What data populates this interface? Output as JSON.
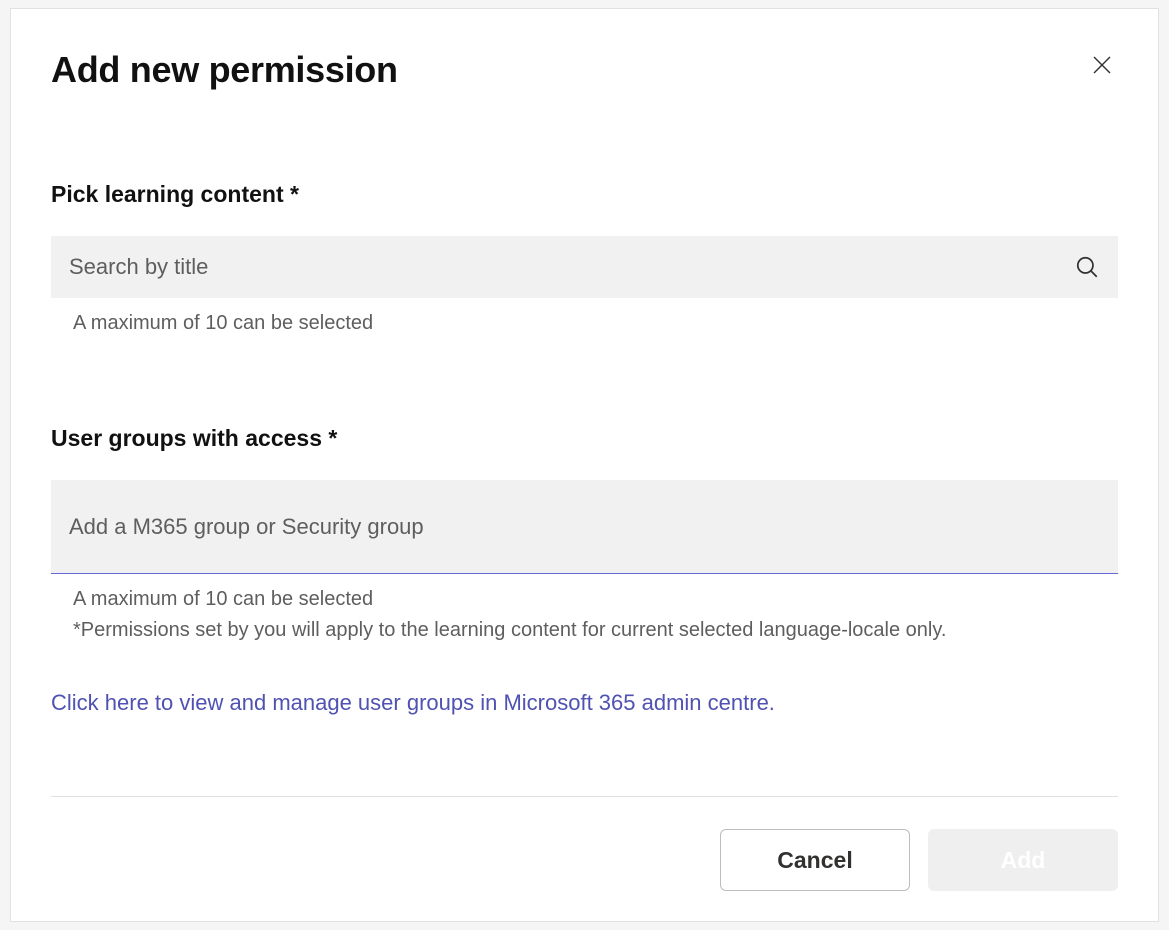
{
  "title": "Add new permission",
  "sections": {
    "content": {
      "label": "Pick learning content *",
      "placeholder": "Search by title",
      "helper": "A maximum of 10 can be selected"
    },
    "groups": {
      "label": "User groups with access *",
      "placeholder": "Add a M365 group or Security group",
      "helper": "A maximum of 10 can be selected",
      "note": "*Permissions set by you will apply to the learning content for current selected language-locale only."
    }
  },
  "link": "Click here to view and manage user groups in Microsoft 365 admin centre.",
  "buttons": {
    "cancel": "Cancel",
    "add": "Add"
  }
}
